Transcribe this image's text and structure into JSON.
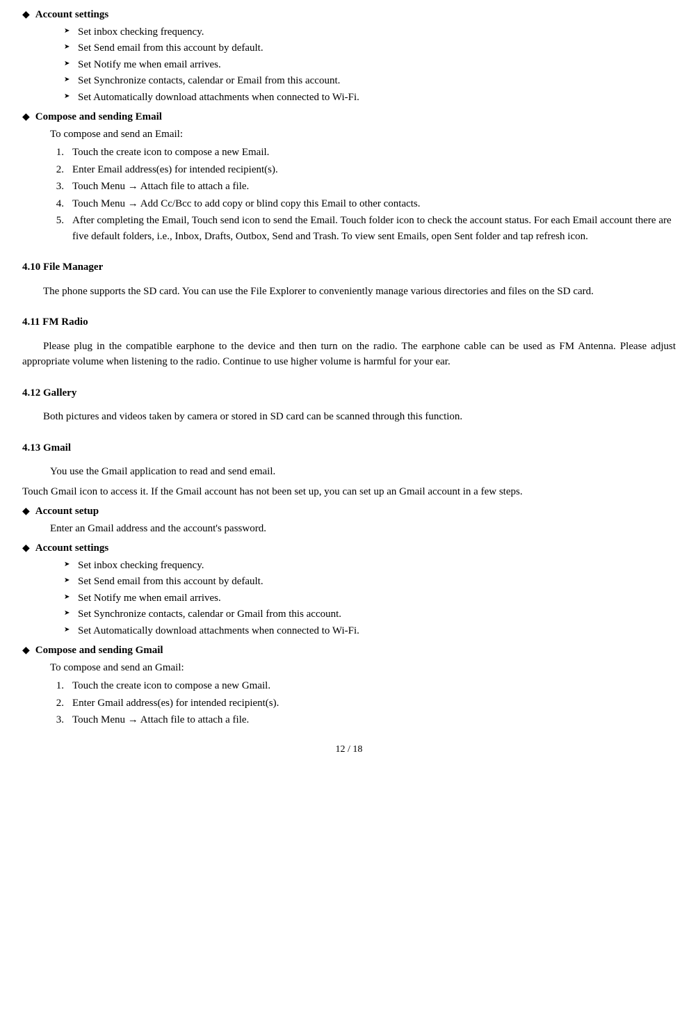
{
  "sections": {
    "account_settings_1": {
      "title": "Account settings",
      "items": [
        "Set inbox checking frequency.",
        "Set Send email from this account by default.",
        "Set Notify me when email arrives.",
        "Set Synchronize contacts, calendar or Email from this account.",
        "Set Automatically download attachments when connected to Wi-Fi."
      ]
    },
    "compose_email": {
      "title": "Compose and sending Email",
      "intro": "To compose and send an Email:",
      "steps": [
        "Touch the create icon to compose a new Email.",
        "Enter Email address(es) for intended recipient(s).",
        "Touch Menu  →  Attach file to attach a file.",
        "Touch Menu  →  Add Cc/Bcc to add copy or blind copy this Email to other contacts.",
        "After completing the Email, Touch send icon to send the Email. Touch folder icon to check the account status. For each Email account there are five default folders, i.e., Inbox, Drafts, Outbox, Send and Trash. To view sent Emails, open Sent folder and tap refresh icon."
      ]
    },
    "section_410": {
      "heading": "4.10  File Manager",
      "paragraph": "The phone supports the SD card. You can use the File Explorer to conveniently manage various directories and files on the SD card."
    },
    "section_411": {
      "heading": "4.11  FM Radio",
      "paragraph": "Please plug in the compatible earphone to the device and then turn on the radio. The earphone cable can be used as FM Antenna. Please adjust appropriate volume when listening to the radio. Continue to use higher volume is harmful for your ear."
    },
    "section_412": {
      "heading": "4.12  Gallery",
      "paragraph": "Both pictures and videos taken by camera or stored in SD card can be scanned through this function."
    },
    "section_413": {
      "heading": "4.13  Gmail",
      "para1": "You use the Gmail application to read and send email.",
      "para2": "Touch Gmail icon to access it. If the Gmail account has not been set up, you can set up an Gmail account in a few steps."
    },
    "account_setup": {
      "title": "Account setup",
      "text": "Enter an Gmail address and the account's password."
    },
    "account_settings_2": {
      "title": "Account settings",
      "items": [
        "Set inbox checking frequency.",
        "Set Send email from this account by default.",
        "Set Notify me when email arrives.",
        "Set Synchronize contacts, calendar or Gmail from this account.",
        "Set Automatically download attachments when connected to Wi-Fi."
      ]
    },
    "compose_gmail": {
      "title": "Compose and sending Gmail",
      "intro": "To compose and send an Gmail:",
      "steps": [
        "Touch the create icon to compose a new Gmail.",
        "Enter Gmail address(es) for intended recipient(s).",
        "Touch Menu  →  Attach file to attach a file."
      ]
    }
  },
  "page_number": "12 / 18"
}
